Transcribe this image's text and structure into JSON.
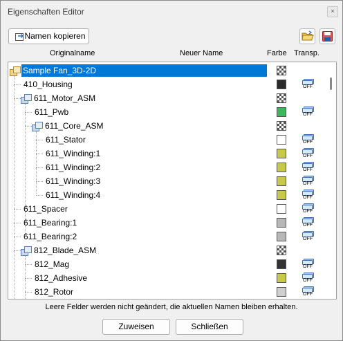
{
  "window": {
    "title": "Eigenschaften Editor",
    "close_glyph": "×"
  },
  "toolbar": {
    "copy_names_label": "Namen kopieren"
  },
  "columns": {
    "original": "Originalname",
    "new": "Neuer Name",
    "color": "Farbe",
    "transp": "Transp."
  },
  "transp_off_label": "OFF",
  "rows": [
    {
      "name": "Sample Fan_3D-2D",
      "kind": "root",
      "color": "checker",
      "transp": false,
      "selected": true
    },
    {
      "name": "410_Housing",
      "kind": "part",
      "color": "#2b2b2b",
      "transp": true
    },
    {
      "name": "611_Motor_ASM",
      "kind": "asm",
      "color": "checker",
      "transp": false
    },
    {
      "name": "611_Pwb",
      "kind": "part",
      "color": "#3cb85a",
      "transp": true
    },
    {
      "name": "611_Core_ASM",
      "kind": "asm",
      "color": "checker",
      "transp": false
    },
    {
      "name": "611_Stator",
      "kind": "part",
      "color": "#ffffff",
      "transp": true
    },
    {
      "name": "611_Winding:1",
      "kind": "part",
      "color": "#c8c84a",
      "transp": true
    },
    {
      "name": "611_Winding:2",
      "kind": "part",
      "color": "#c8c84a",
      "transp": true
    },
    {
      "name": "611_Winding:3",
      "kind": "part",
      "color": "#c8c84a",
      "transp": true
    },
    {
      "name": "611_Winding:4",
      "kind": "part",
      "color": "#c8c84a",
      "transp": true
    },
    {
      "name": "611_Spacer",
      "kind": "part",
      "color": "#ffffff",
      "transp": true
    },
    {
      "name": "611_Bearing:1",
      "kind": "part",
      "color": "#b8b8b8",
      "transp": true
    },
    {
      "name": "611_Bearing:2",
      "kind": "part",
      "color": "#b8b8b8",
      "transp": true
    },
    {
      "name": "812_Blade_ASM",
      "kind": "asm",
      "color": "checker",
      "transp": false
    },
    {
      "name": "812_Mag",
      "kind": "part",
      "color": "#333333",
      "transp": true
    },
    {
      "name": "812_Adhesive",
      "kind": "part",
      "color": "#c8c84a",
      "transp": true
    },
    {
      "name": "812_Rotor",
      "kind": "part",
      "color": "#d0d0d0",
      "transp": true
    }
  ],
  "hint": "Leere Felder werden nicht geändert, die aktuellen Namen bleiben erhalten.",
  "buttons": {
    "assign": "Zuweisen",
    "close": "Schließen"
  },
  "colors": {
    "selection": "#0078d7",
    "accent_transp": "#3d6fb0"
  }
}
